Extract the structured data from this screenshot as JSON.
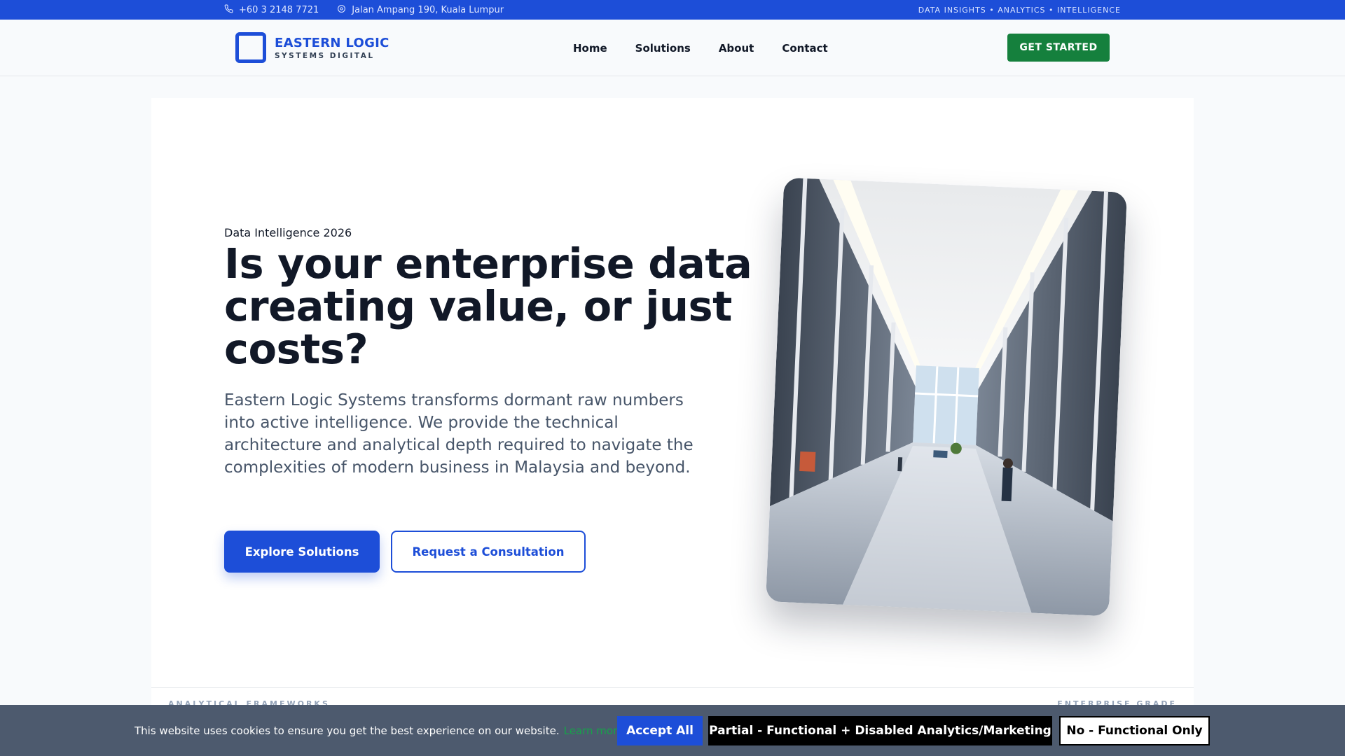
{
  "topbar": {
    "phone": "+60 3 2148 7721",
    "address": "Jalan Ampang 190, Kuala Lumpur",
    "tagline": "DATA INSIGHTS • ANALYTICS • INTELLIGENCE"
  },
  "header": {
    "logo_title": "EASTERN LOGIC",
    "logo_subtitle": "SYSTEMS DIGITAL",
    "nav": [
      "Home",
      "Solutions",
      "About",
      "Contact"
    ],
    "cta_label": "GET STARTED"
  },
  "hero": {
    "eyebrow": "Data Intelligence 2026",
    "headline": "Is your enterprise data creating value, or just costs?",
    "lead": "Eastern Logic Systems transforms dormant raw numbers into active intelligence. We provide the technical architecture and analytical depth required to navigate the complexities of modern business in Malaysia and beyond.",
    "primary_button": "Explore Solutions",
    "secondary_button": "Request a Consultation"
  },
  "below": {
    "left_label": "ANALYTICAL FRAMEWORKS",
    "right_label": "ENTERPRISE GRADE"
  },
  "cookie": {
    "message": "This website uses cookies to ensure you get the best experience on our website.",
    "learn_more": "Learn more",
    "accept_all": "Accept All",
    "partial": "Partial - Functional + Disabled Analytics/Marketing",
    "functional_only": "No - Functional Only"
  },
  "colors": {
    "primary": "#1d4ed8",
    "green": "#15803d",
    "heading": "#111827",
    "cookie_bg": "#475569"
  },
  "icons": {
    "phone": "phone-icon",
    "location": "map-pin-icon"
  }
}
